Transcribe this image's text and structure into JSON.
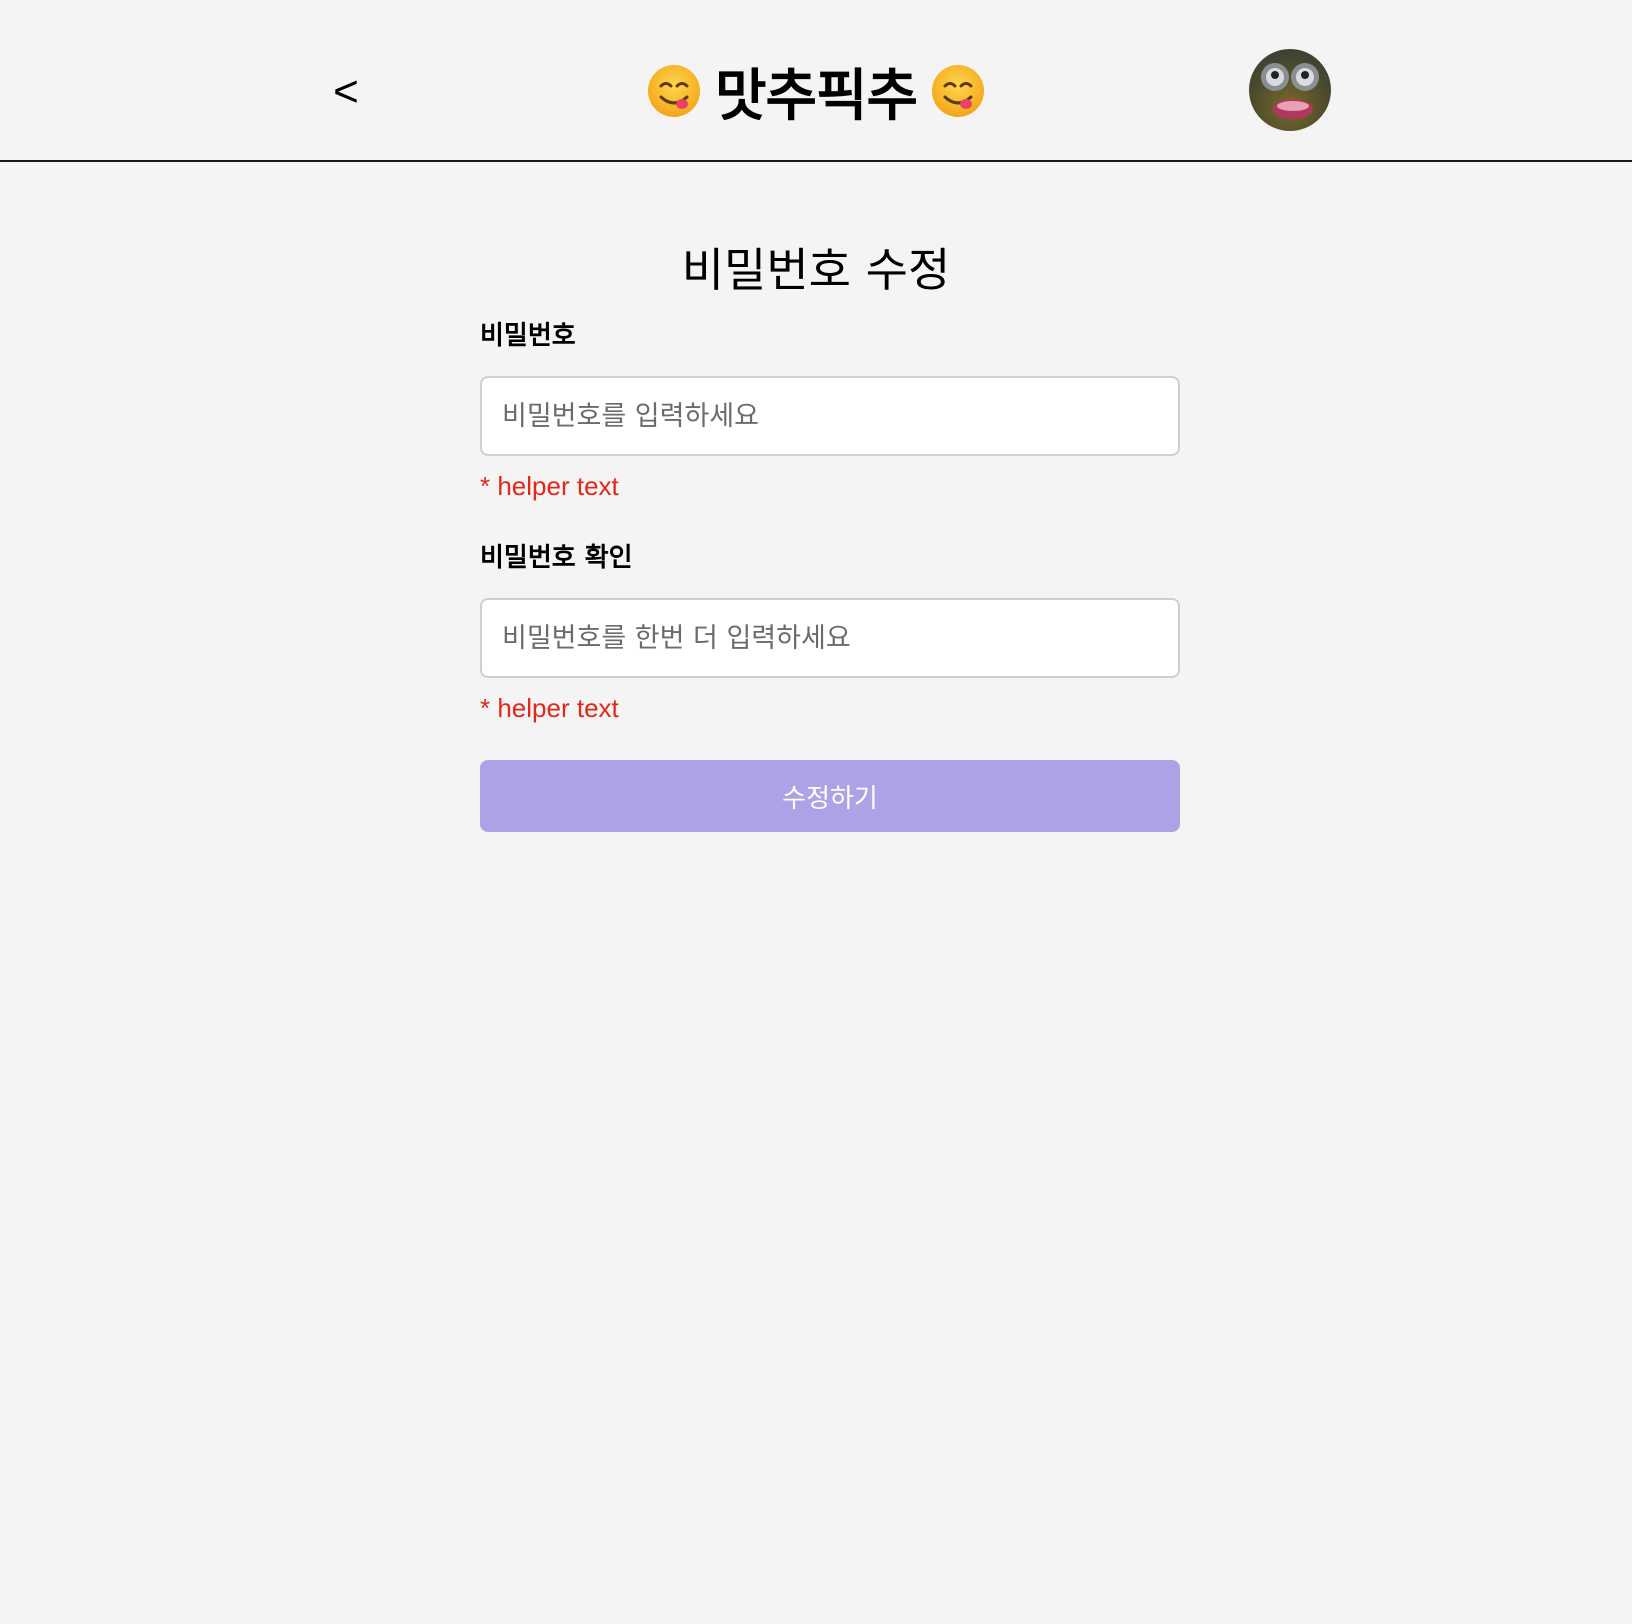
{
  "header": {
    "back_label": "<",
    "brand_title": "맛추픽추",
    "left_emoji": "face-savoring-food-icon",
    "right_emoji": "face-savoring-food-icon",
    "avatar": "user-avatar-icon"
  },
  "main": {
    "title": "비밀번호 수정",
    "password": {
      "label": "비밀번호",
      "placeholder": "비밀번호를 입력하세요",
      "helper": "* helper text"
    },
    "password_confirm": {
      "label": "비밀번호 확인",
      "placeholder": "비밀번호를 한번 더 입력하세요",
      "helper": "* helper text"
    },
    "submit_label": "수정하기"
  },
  "colors": {
    "background": "#f4f4f4",
    "accent_button": "#aba3e6",
    "helper_text": "#e0281b"
  }
}
